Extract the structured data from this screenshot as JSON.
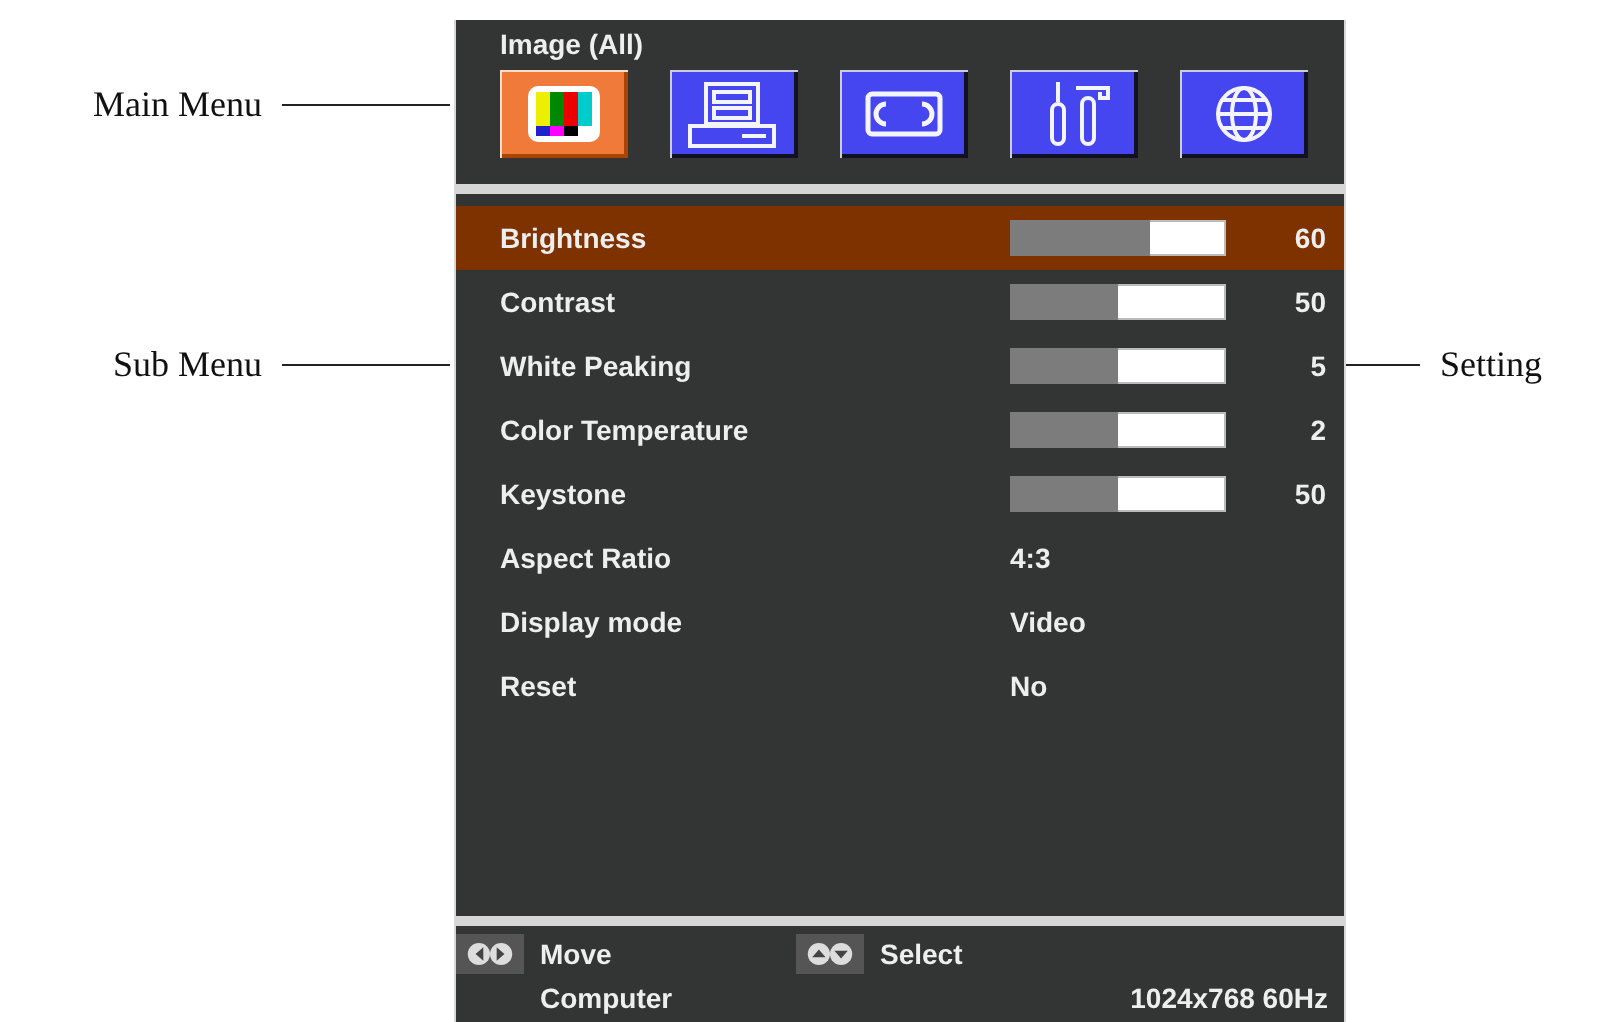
{
  "annotations": [
    {
      "label": "Main Menu",
      "kind": "left"
    },
    {
      "label": "Sub Menu",
      "kind": "left"
    },
    {
      "label": "Setting",
      "kind": "right"
    }
  ],
  "menu": {
    "title": "Image (All)",
    "tabs": [
      {
        "kind": "colorbars",
        "selected": true
      },
      {
        "kind": "computer",
        "selected": false
      },
      {
        "kind": "tape",
        "selected": false
      },
      {
        "kind": "tools",
        "selected": false
      },
      {
        "kind": "globe",
        "selected": false
      }
    ]
  },
  "items": [
    {
      "kind": "slider",
      "label": "Brightness",
      "level": 0.65,
      "reading": "60",
      "selected": true
    },
    {
      "kind": "slider",
      "label": "Contrast",
      "level": 0.5,
      "reading": "50",
      "selected": false
    },
    {
      "kind": "slider",
      "label": "White Peaking",
      "level": 0.5,
      "reading": "5",
      "selected": false
    },
    {
      "kind": "slider",
      "label": "Color Temperature",
      "level": 0.5,
      "reading": "2",
      "selected": false
    },
    {
      "kind": "slider",
      "label": "Keystone",
      "level": 0.5,
      "reading": "50",
      "selected": false
    },
    {
      "kind": "option",
      "label": "Aspect Ratio",
      "value": "4:3",
      "selected": false
    },
    {
      "kind": "option",
      "label": "Display mode",
      "value": "Video",
      "selected": false
    },
    {
      "kind": "option",
      "label": "Reset",
      "value": "No",
      "selected": false
    }
  ],
  "footer": {
    "hints": [
      {
        "kind": "left-right",
        "label": "Move"
      },
      {
        "kind": "up-down",
        "label": "Select"
      }
    ],
    "source": "Computer",
    "resolution": "1024x768 60Hz"
  }
}
